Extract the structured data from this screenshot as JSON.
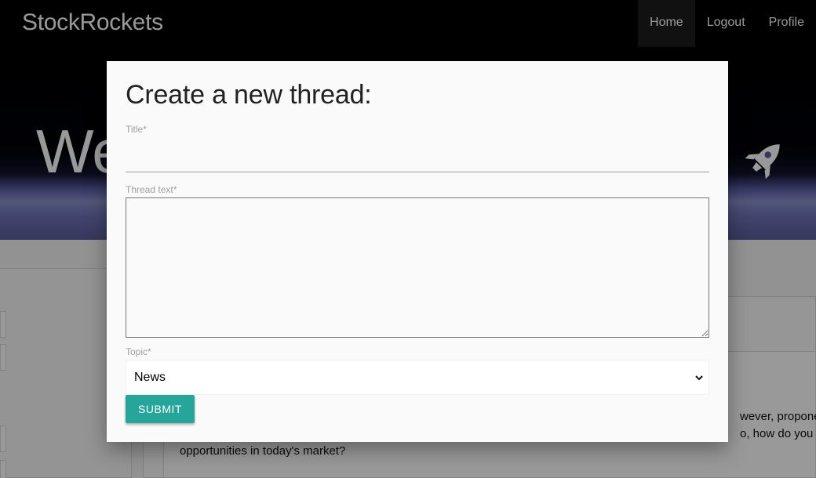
{
  "navbar": {
    "brand": "StockRockets",
    "links": [
      {
        "label": "Home",
        "active": true
      },
      {
        "label": "Logout",
        "active": false
      },
      {
        "label": "Profile",
        "active": false
      }
    ]
  },
  "hero": {
    "title_visible": "We",
    "icon": "rocket-icon"
  },
  "background_post": {
    "line1": "wever, proponents",
    "line2": "o, how do you ide",
    "line3": "opportunities in today's market?"
  },
  "modal": {
    "title": "Create a new thread:",
    "title_label": "Title*",
    "title_value": "",
    "thread_text_label": "Thread text*",
    "thread_text_value": "",
    "topic_label": "Topic*",
    "topic_selected": "News",
    "submit_label": "SUBMIT"
  },
  "colors": {
    "accent": "#26a69a",
    "navbar": "#000000",
    "modal_bg": "#fafafa"
  }
}
